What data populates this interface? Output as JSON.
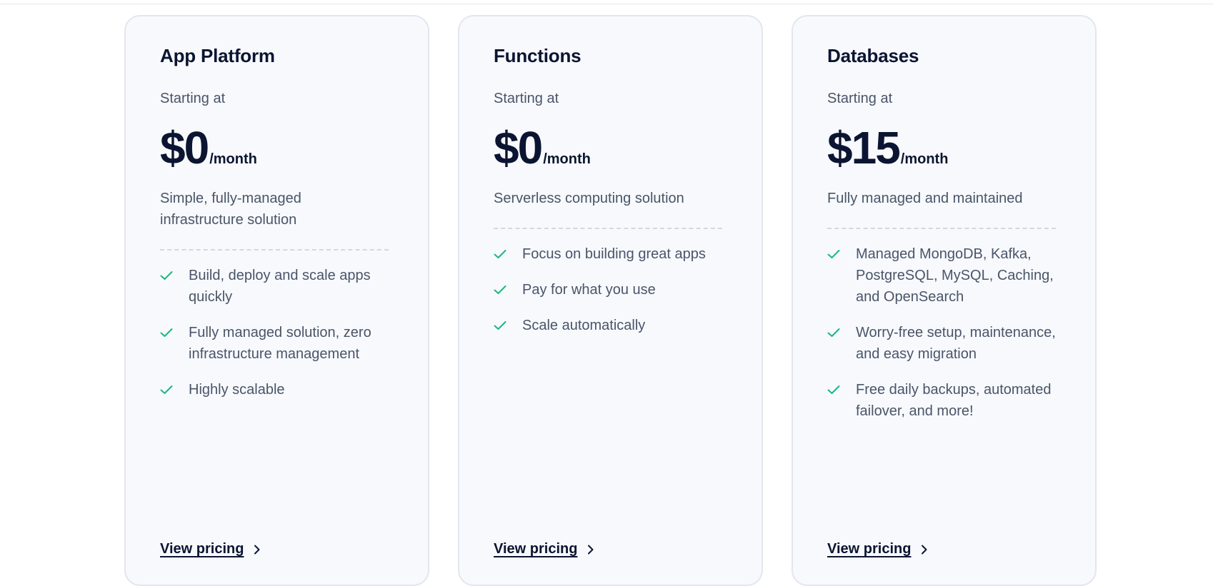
{
  "cards": [
    {
      "title": "App Platform",
      "starting_label": "Starting at",
      "price": "$0",
      "price_unit": "/month",
      "description": "Simple, fully-managed infrastructure solution",
      "features": [
        "Build, deploy and scale apps quickly",
        "Fully managed solution, zero infrastructure management",
        "Highly scalable"
      ],
      "link_label": "View pricing"
    },
    {
      "title": "Functions",
      "starting_label": "Starting at",
      "price": "$0",
      "price_unit": "/month",
      "description": "Serverless computing solution",
      "features": [
        "Focus on building great apps",
        "Pay for what you use",
        "Scale automatically"
      ],
      "link_label": "View pricing"
    },
    {
      "title": "Databases",
      "starting_label": "Starting at",
      "price": "$15",
      "price_unit": "/month",
      "description": "Fully managed and maintained",
      "features": [
        "Managed MongoDB, Kafka, PostgreSQL, MySQL, Caching, and OpenSearch",
        "Worry-free setup, maintenance, and easy migration",
        "Free daily backups, automated failover, and more!"
      ],
      "link_label": "View pricing"
    }
  ],
  "icons": {
    "feature_check": "check-icon",
    "link_arrow": "arrow-right-icon"
  },
  "colors": {
    "check": "#17b97a",
    "heading": "#0b1531",
    "body_text": "#4a5568",
    "card_bg": "#f7f9fd",
    "card_border": "#e3e6ee"
  }
}
